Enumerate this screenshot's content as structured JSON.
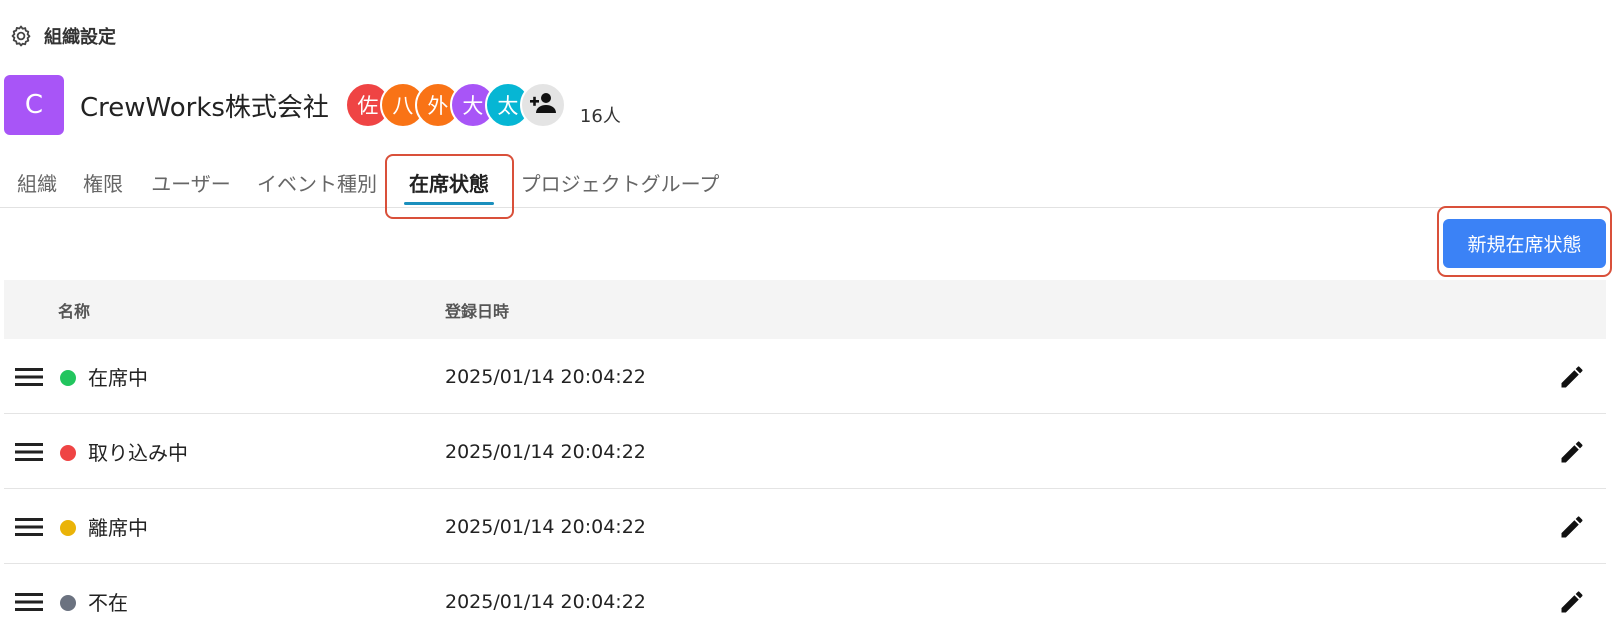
{
  "header": {
    "title": "組織設定",
    "icon": "gear-icon"
  },
  "org": {
    "logo_letter": "C",
    "logo_color": "#a855f7",
    "name": "CrewWorks株式会社",
    "avatars": [
      {
        "label": "佐",
        "color": "#ef4444"
      },
      {
        "label": "八",
        "color": "#f97316"
      },
      {
        "label": "外",
        "color": "#f97316"
      },
      {
        "label": "大",
        "color": "#a855f7"
      },
      {
        "label": "太",
        "color": "#06b6d4"
      }
    ],
    "add_member_icon": "person-add-icon",
    "member_count": "16人"
  },
  "tabs": [
    {
      "label": "組織"
    },
    {
      "label": "権限"
    },
    {
      "label": "ユーザー"
    },
    {
      "label": "イベント種別"
    },
    {
      "label": "在席状態",
      "active": true
    },
    {
      "label": "プロジェクトグループ"
    }
  ],
  "accent_color": "#1a8fbd",
  "highlight_color": "#d9503a",
  "new_button": {
    "label": "新規在席状態",
    "color": "#3b82f6"
  },
  "table": {
    "columns": [
      "名称",
      "登録日時"
    ],
    "rows": [
      {
        "name": "在席中",
        "color": "#22c55e",
        "date": "2025/01/14 20:04:22"
      },
      {
        "name": "取り込み中",
        "color": "#ef4444",
        "date": "2025/01/14 20:04:22"
      },
      {
        "name": "離席中",
        "color": "#eab308",
        "date": "2025/01/14 20:04:22"
      },
      {
        "name": "不在",
        "color": "#6b7280",
        "date": "2025/01/14 20:04:22"
      }
    ],
    "row_icons": {
      "drag": "drag-handle-icon",
      "edit": "pencil-icon"
    }
  }
}
